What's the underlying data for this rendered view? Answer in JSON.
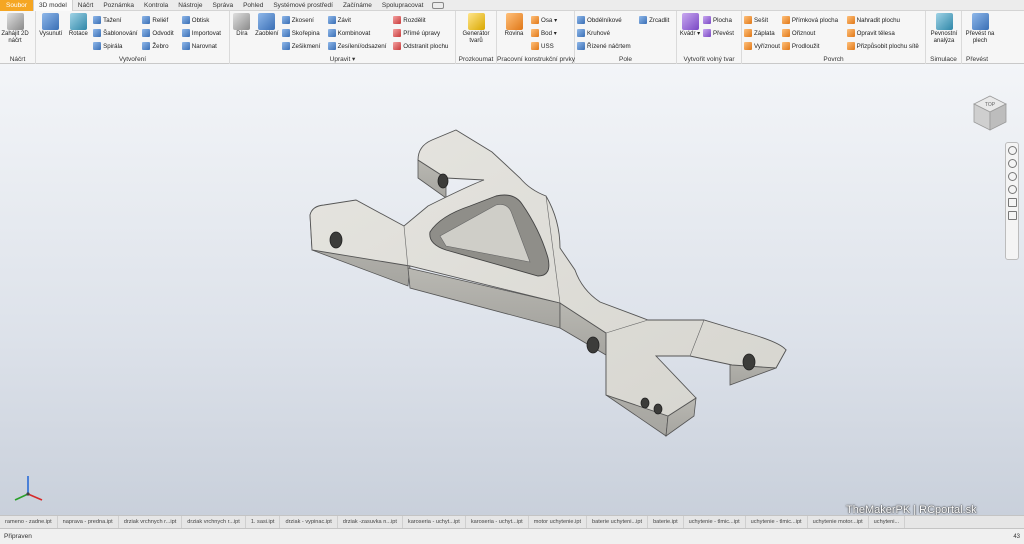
{
  "tabs": [
    {
      "label": "Soubor",
      "type": "file"
    },
    {
      "label": "3D model",
      "type": "active"
    },
    {
      "label": "Náčrt"
    },
    {
      "label": "Poznámka"
    },
    {
      "label": "Kontrola"
    },
    {
      "label": "Nástroje"
    },
    {
      "label": "Správa"
    },
    {
      "label": "Pohled"
    },
    {
      "label": "Systémové prostředí"
    },
    {
      "label": "Začínáme"
    },
    {
      "label": "Spolupracovat"
    }
  ],
  "ribbon": {
    "nacrt": {
      "label": "Náčrt",
      "start_sketch": "Zahájit 2D náčrt"
    },
    "vytvoreni": {
      "label": "Vytvoření",
      "extrude": "Vysunutí",
      "revolve": "Rotace",
      "col1": [
        "Tažení",
        "Šablonování",
        "Spirála"
      ],
      "col2": [
        "Reliéf",
        "Odvodit",
        "Žebro"
      ],
      "col3": [
        "Obtisk",
        "Importovat",
        "Narovnat"
      ]
    },
    "upravit": {
      "label": "Upravit ▾",
      "hole": "Díra",
      "fillet": "Zaoblení",
      "col1": [
        "Zkosení",
        "Skořepina",
        "Zešikmení"
      ],
      "col2": [
        "Závit",
        "Kombinovat",
        "Zesílení/odsazení"
      ],
      "col3": [
        "Rozdělit",
        "Přímé úpravy",
        "Odstranit plochu"
      ]
    },
    "prozkoumat": {
      "label": "Prozkoumat",
      "generator": "Generátor tvarů"
    },
    "konstrukcni": {
      "label": "Pracovní konstrukční prvky",
      "plane": "Rovina",
      "col": [
        "Osa ▾",
        "Bod ▾",
        "USS"
      ]
    },
    "pole": {
      "label": "Pole",
      "col1": [
        "Obdélníkové",
        "Kruhové",
        "Řízené náčrtem"
      ],
      "mirror": "Zrcadlit"
    },
    "volny": {
      "label": "Vytvořit volný tvar",
      "box": "Kvádr ▾",
      "col": [
        "Plocha",
        "Převést"
      ]
    },
    "povrch": {
      "label": "Povrch",
      "col1": [
        "Sešít",
        "Záplata",
        "Vyříznout"
      ],
      "col2": [
        "Přímková plocha",
        "Ořiznout",
        "Prodloužit"
      ],
      "col3": [
        "Nahradit plochu",
        "Opravit tělesa",
        "Přizpůsobit plochu sítě"
      ]
    },
    "simulace": {
      "label": "Simulace",
      "stress": "Pevnostní analýza"
    },
    "prevest": {
      "label": "Převést",
      "convert": "Převést na plech"
    }
  },
  "viewcube": {
    "face": "TOP"
  },
  "watermark": "TheMakerPK | RCportal.sk",
  "doc_tabs": [
    "rameno - zadne.ipt",
    "naprava - predna.ipt",
    "drziak vrchnych r...ipt",
    "drziak vrchnych r...ipt",
    "1. sasi.ipt",
    "drziak - vypinac.ipt",
    "drziak -zasuvka n...ipt",
    "karoseria - uchyt...ipt",
    "karoseria - uchyt...ipt",
    "motor uchytenie.ipt",
    "baterie uchyteni...ipt",
    "baterie.ipt",
    "uchytenie - tlmic...ipt",
    "uchytenie - tlmic...ipt",
    "uchytenie motor...ipt",
    "uchyteni..."
  ],
  "status": {
    "text": "Připraven",
    "count": "43"
  },
  "colors": {
    "accent": "#f5a623",
    "model": "#d9d8d3"
  }
}
